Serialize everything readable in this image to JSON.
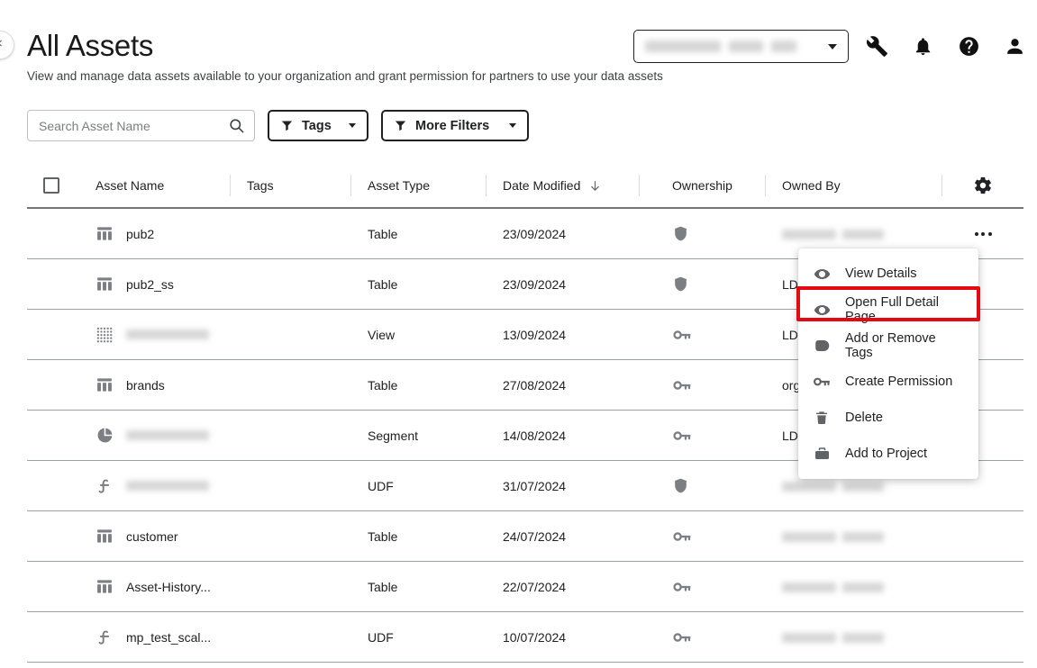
{
  "header": {
    "title": "All Assets",
    "subtitle": "View and manage data assets available to your organization and grant permission for partners to use your data assets",
    "collapse_icon": "chevron-left-icon",
    "org_selector": {
      "value": "",
      "redacted": true
    },
    "icons": [
      {
        "name": "wrench-icon",
        "label": "Tools"
      },
      {
        "name": "bell-icon",
        "label": "Notifications"
      },
      {
        "name": "help-icon",
        "label": "Help"
      },
      {
        "name": "user-icon",
        "label": "Account"
      }
    ]
  },
  "toolbar": {
    "search_placeholder": "Search Asset Name",
    "search_value": "",
    "search_icon": "search-icon",
    "tags_label": "Tags",
    "more_filters_label": "More Filters",
    "filter_icon": "funnel-icon"
  },
  "table": {
    "columns": {
      "asset_name": "Asset Name",
      "tags": "Tags",
      "asset_type": "Asset Type",
      "date_modified": "Date Modified",
      "ownership": "Ownership",
      "owned_by": "Owned By"
    },
    "sort": {
      "column": "Date Modified",
      "direction": "descending",
      "icon": "arrow-down-icon"
    },
    "settings_icon": "gear-icon",
    "select_all_checked": false,
    "rows": [
      {
        "icon": "table-icon",
        "name": "pub2",
        "redacted_name": false,
        "tags": "",
        "type": "Table",
        "date": "23/09/2024",
        "ownership_icon": "shield-icon",
        "owned_by": "",
        "redacted_owner": true,
        "menu_open": true
      },
      {
        "icon": "table-icon",
        "name": "pub2_ss",
        "redacted_name": false,
        "tags": "",
        "type": "Table",
        "date": "23/09/2024",
        "ownership_icon": "shield-icon",
        "owned_by": "LDH",
        "redacted_owner": false,
        "menu_open": false
      },
      {
        "icon": "view-icon",
        "name": "",
        "redacted_name": true,
        "tags": "",
        "type": "View",
        "date": "13/09/2024",
        "ownership_icon": "key-icon",
        "owned_by": "LDH",
        "redacted_owner": false,
        "menu_open": false
      },
      {
        "icon": "table-icon",
        "name": "brands",
        "redacted_name": false,
        "tags": "",
        "type": "Table",
        "date": "27/08/2024",
        "ownership_icon": "key-icon",
        "owned_by": "org c",
        "redacted_owner": false,
        "menu_open": false
      },
      {
        "icon": "segment-icon",
        "name": "",
        "redacted_name": true,
        "tags": "",
        "type": "Segment",
        "date": "14/08/2024",
        "ownership_icon": "key-icon",
        "owned_by": "LDH",
        "redacted_owner": false,
        "menu_open": false
      },
      {
        "icon": "udf-icon",
        "name": "",
        "redacted_name": true,
        "tags": "",
        "type": "UDF",
        "date": "31/07/2024",
        "ownership_icon": "shield-icon",
        "owned_by": "",
        "redacted_owner": true,
        "menu_open": false
      },
      {
        "icon": "table-icon",
        "name": "customer",
        "redacted_name": false,
        "tags": "",
        "type": "Table",
        "date": "24/07/2024",
        "ownership_icon": "key-icon",
        "owned_by": "",
        "redacted_owner": true,
        "menu_open": false
      },
      {
        "icon": "table-icon",
        "name": "Asset-History...",
        "redacted_name": false,
        "tags": "",
        "type": "Table",
        "date": "22/07/2024",
        "ownership_icon": "key-icon",
        "owned_by": "",
        "redacted_owner": true,
        "menu_open": false
      },
      {
        "icon": "udf-icon",
        "name": "mp_test_scal...",
        "redacted_name": false,
        "tags": "",
        "type": "UDF",
        "date": "10/07/2024",
        "ownership_icon": "key-icon",
        "owned_by": "",
        "redacted_owner": true,
        "menu_open": false
      }
    ]
  },
  "context_menu": {
    "highlight_color": "#e50914",
    "highlighted_item": "Open Full Detail Page",
    "items": [
      {
        "label": "View Details",
        "icon": "eye-icon"
      },
      {
        "label": "Open Full Detail Page",
        "icon": "eye-icon"
      },
      {
        "label": "Add or Remove Tags",
        "icon": "tag-icon"
      },
      {
        "label": "Create Permission",
        "icon": "key-icon"
      },
      {
        "label": "Delete",
        "icon": "trash-icon"
      },
      {
        "label": "Add to Project",
        "icon": "briefcase-icon"
      }
    ]
  }
}
